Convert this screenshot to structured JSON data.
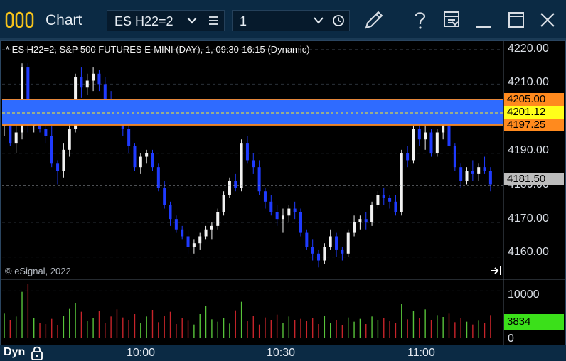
{
  "window": {
    "title": "Chart",
    "symbol": "ES H22=2",
    "interval": "1",
    "colors": {
      "titlebar": "#0b2a44",
      "accent": "#2f6bff"
    }
  },
  "chart": {
    "header": "* ES H22=2, S&P 500 FUTURES E-MINI (DAY), 1, 09:30-16:15 (Dynamic)",
    "copyright": "© eSignal, 2022",
    "price_axis": [
      "4220.00",
      "4210.00",
      "4190.00",
      "4180.00",
      "4170.00",
      "4160.00"
    ],
    "volume_axis": [
      "10000",
      "0"
    ],
    "time_axis": [
      "10:00",
      "10:30",
      "11:00"
    ],
    "bottom_label": "Dyn",
    "markers": {
      "upper": "4205.00",
      "mid": "4201.12",
      "lower": "4197.25",
      "last": "4181.50",
      "volume_last": "3834"
    }
  },
  "chart_data": {
    "type": "candlestick",
    "price_range": [
      4155,
      4222
    ],
    "volume_range": [
      0,
      12000
    ],
    "time_labels": [
      "10:00",
      "10:30",
      "11:00"
    ],
    "candles": [
      [
        4198,
        4204,
        4195,
        4201
      ],
      [
        4201,
        4203,
        4192,
        4193
      ],
      [
        4193,
        4200,
        4190,
        4196
      ],
      [
        4196,
        4216,
        4194,
        4215
      ],
      [
        4215,
        4216,
        4196,
        4198
      ],
      [
        4198,
        4205,
        4196,
        4203
      ],
      [
        4203,
        4204,
        4196,
        4197
      ],
      [
        4197,
        4200,
        4193,
        4195
      ],
      [
        4195,
        4198,
        4186,
        4187
      ],
      [
        4187,
        4188,
        4181,
        4185
      ],
      [
        4185,
        4193,
        4183,
        4191
      ],
      [
        4191,
        4199,
        4189,
        4197
      ],
      [
        4197,
        4213,
        4196,
        4212
      ],
      [
        4212,
        4215,
        4206,
        4209
      ],
      [
        4209,
        4213,
        4207,
        4211
      ],
      [
        4211,
        4215,
        4208,
        4213
      ],
      [
        4213,
        4214,
        4208,
        4210
      ],
      [
        4210,
        4212,
        4203,
        4205
      ],
      [
        4205,
        4208,
        4200,
        4203
      ],
      [
        4203,
        4205,
        4198,
        4199
      ],
      [
        4199,
        4201,
        4195,
        4197
      ],
      [
        4197,
        4199,
        4190,
        4192
      ],
      [
        4192,
        4193,
        4185,
        4186
      ],
      [
        4186,
        4190,
        4184,
        4189
      ],
      [
        4189,
        4191,
        4187,
        4190
      ],
      [
        4190,
        4191,
        4185,
        4186
      ],
      [
        4186,
        4187,
        4179,
        4180
      ],
      [
        4180,
        4182,
        4174,
        4175
      ],
      [
        4175,
        4176,
        4169,
        4171
      ],
      [
        4171,
        4172,
        4167,
        4168
      ],
      [
        4168,
        4169,
        4165,
        4166
      ],
      [
        4166,
        4168,
        4161,
        4163
      ],
      [
        4163,
        4165,
        4161,
        4164
      ],
      [
        4164,
        4167,
        4162,
        4166
      ],
      [
        4166,
        4169,
        4165,
        4168
      ],
      [
        4168,
        4170,
        4165,
        4169
      ],
      [
        4169,
        4174,
        4168,
        4173
      ],
      [
        4173,
        4179,
        4172,
        4178
      ],
      [
        4178,
        4183,
        4177,
        4182
      ],
      [
        4182,
        4184,
        4179,
        4180
      ],
      [
        4180,
        4194,
        4179,
        4193
      ],
      [
        4193,
        4195,
        4187,
        4188
      ],
      [
        4188,
        4190,
        4184,
        4186
      ],
      [
        4186,
        4188,
        4178,
        4179
      ],
      [
        4179,
        4180,
        4174,
        4176
      ],
      [
        4176,
        4178,
        4172,
        4173
      ],
      [
        4173,
        4175,
        4169,
        4171
      ],
      [
        4171,
        4174,
        4167,
        4172
      ],
      [
        4172,
        4175,
        4170,
        4174
      ],
      [
        4174,
        4176,
        4171,
        4173
      ],
      [
        4173,
        4174,
        4166,
        4167
      ],
      [
        4167,
        4168,
        4162,
        4163
      ],
      [
        4163,
        4165,
        4159,
        4161
      ],
      [
        4161,
        4162,
        4157,
        4159
      ],
      [
        4159,
        4164,
        4158,
        4163
      ],
      [
        4163,
        4168,
        4162,
        4166
      ],
      [
        4166,
        4167,
        4160,
        4162
      ],
      [
        4162,
        4163,
        4159,
        4161
      ],
      [
        4161,
        4168,
        4160,
        4167
      ],
      [
        4167,
        4172,
        4166,
        4170
      ],
      [
        4170,
        4172,
        4168,
        4171
      ],
      [
        4171,
        4173,
        4168,
        4170
      ],
      [
        4170,
        4176,
        4169,
        4175
      ],
      [
        4175,
        4179,
        4174,
        4178
      ],
      [
        4178,
        4180,
        4175,
        4177
      ],
      [
        4177,
        4178,
        4174,
        4176
      ],
      [
        4176,
        4178,
        4172,
        4173
      ],
      [
        4173,
        4191,
        4172,
        4190
      ],
      [
        4190,
        4192,
        4186,
        4188
      ],
      [
        4188,
        4198,
        4187,
        4197
      ],
      [
        4197,
        4199,
        4192,
        4194
      ],
      [
        4194,
        4198,
        4191,
        4196
      ],
      [
        4196,
        4197,
        4189,
        4190
      ],
      [
        4190,
        4197,
        4189,
        4196
      ],
      [
        4196,
        4201,
        4194,
        4198
      ],
      [
        4198,
        4199,
        4191,
        4192
      ],
      [
        4192,
        4193,
        4185,
        4186
      ],
      [
        4186,
        4187,
        4180,
        4182
      ],
      [
        4182,
        4186,
        4181,
        4185
      ],
      [
        4185,
        4188,
        4182,
        4184
      ],
      [
        4184,
        4187,
        4182,
        4186
      ],
      [
        4186,
        4189,
        4184,
        4185
      ],
      [
        4185,
        4186,
        4179,
        4181
      ]
    ],
    "volumes": [
      5200,
      3800,
      4600,
      9800,
      11500,
      4200,
      3200,
      3000,
      4100,
      2800,
      4800,
      6200,
      7400,
      5600,
      3600,
      4200,
      5800,
      3300,
      4600,
      6100,
      4400,
      3800,
      5100,
      3200,
      4600,
      6000,
      3400,
      4800,
      5600,
      3000,
      4200,
      3700,
      2900,
      5100,
      6800,
      4000,
      3500,
      4300,
      3100,
      5900,
      7700,
      3600,
      4800,
      2900,
      4400,
      3800,
      5000,
      3300,
      4600,
      3900,
      4100,
      3600,
      4300,
      3000,
      4700,
      3200,
      3900,
      2800,
      4400,
      3500,
      4100,
      3000,
      4600,
      3800,
      4200,
      3600,
      3300,
      7200,
      4000,
      5800,
      4300,
      6100,
      3800,
      4900,
      4500,
      5200,
      3400,
      4200,
      3500,
      2900,
      3700,
      3300,
      4900
    ]
  }
}
